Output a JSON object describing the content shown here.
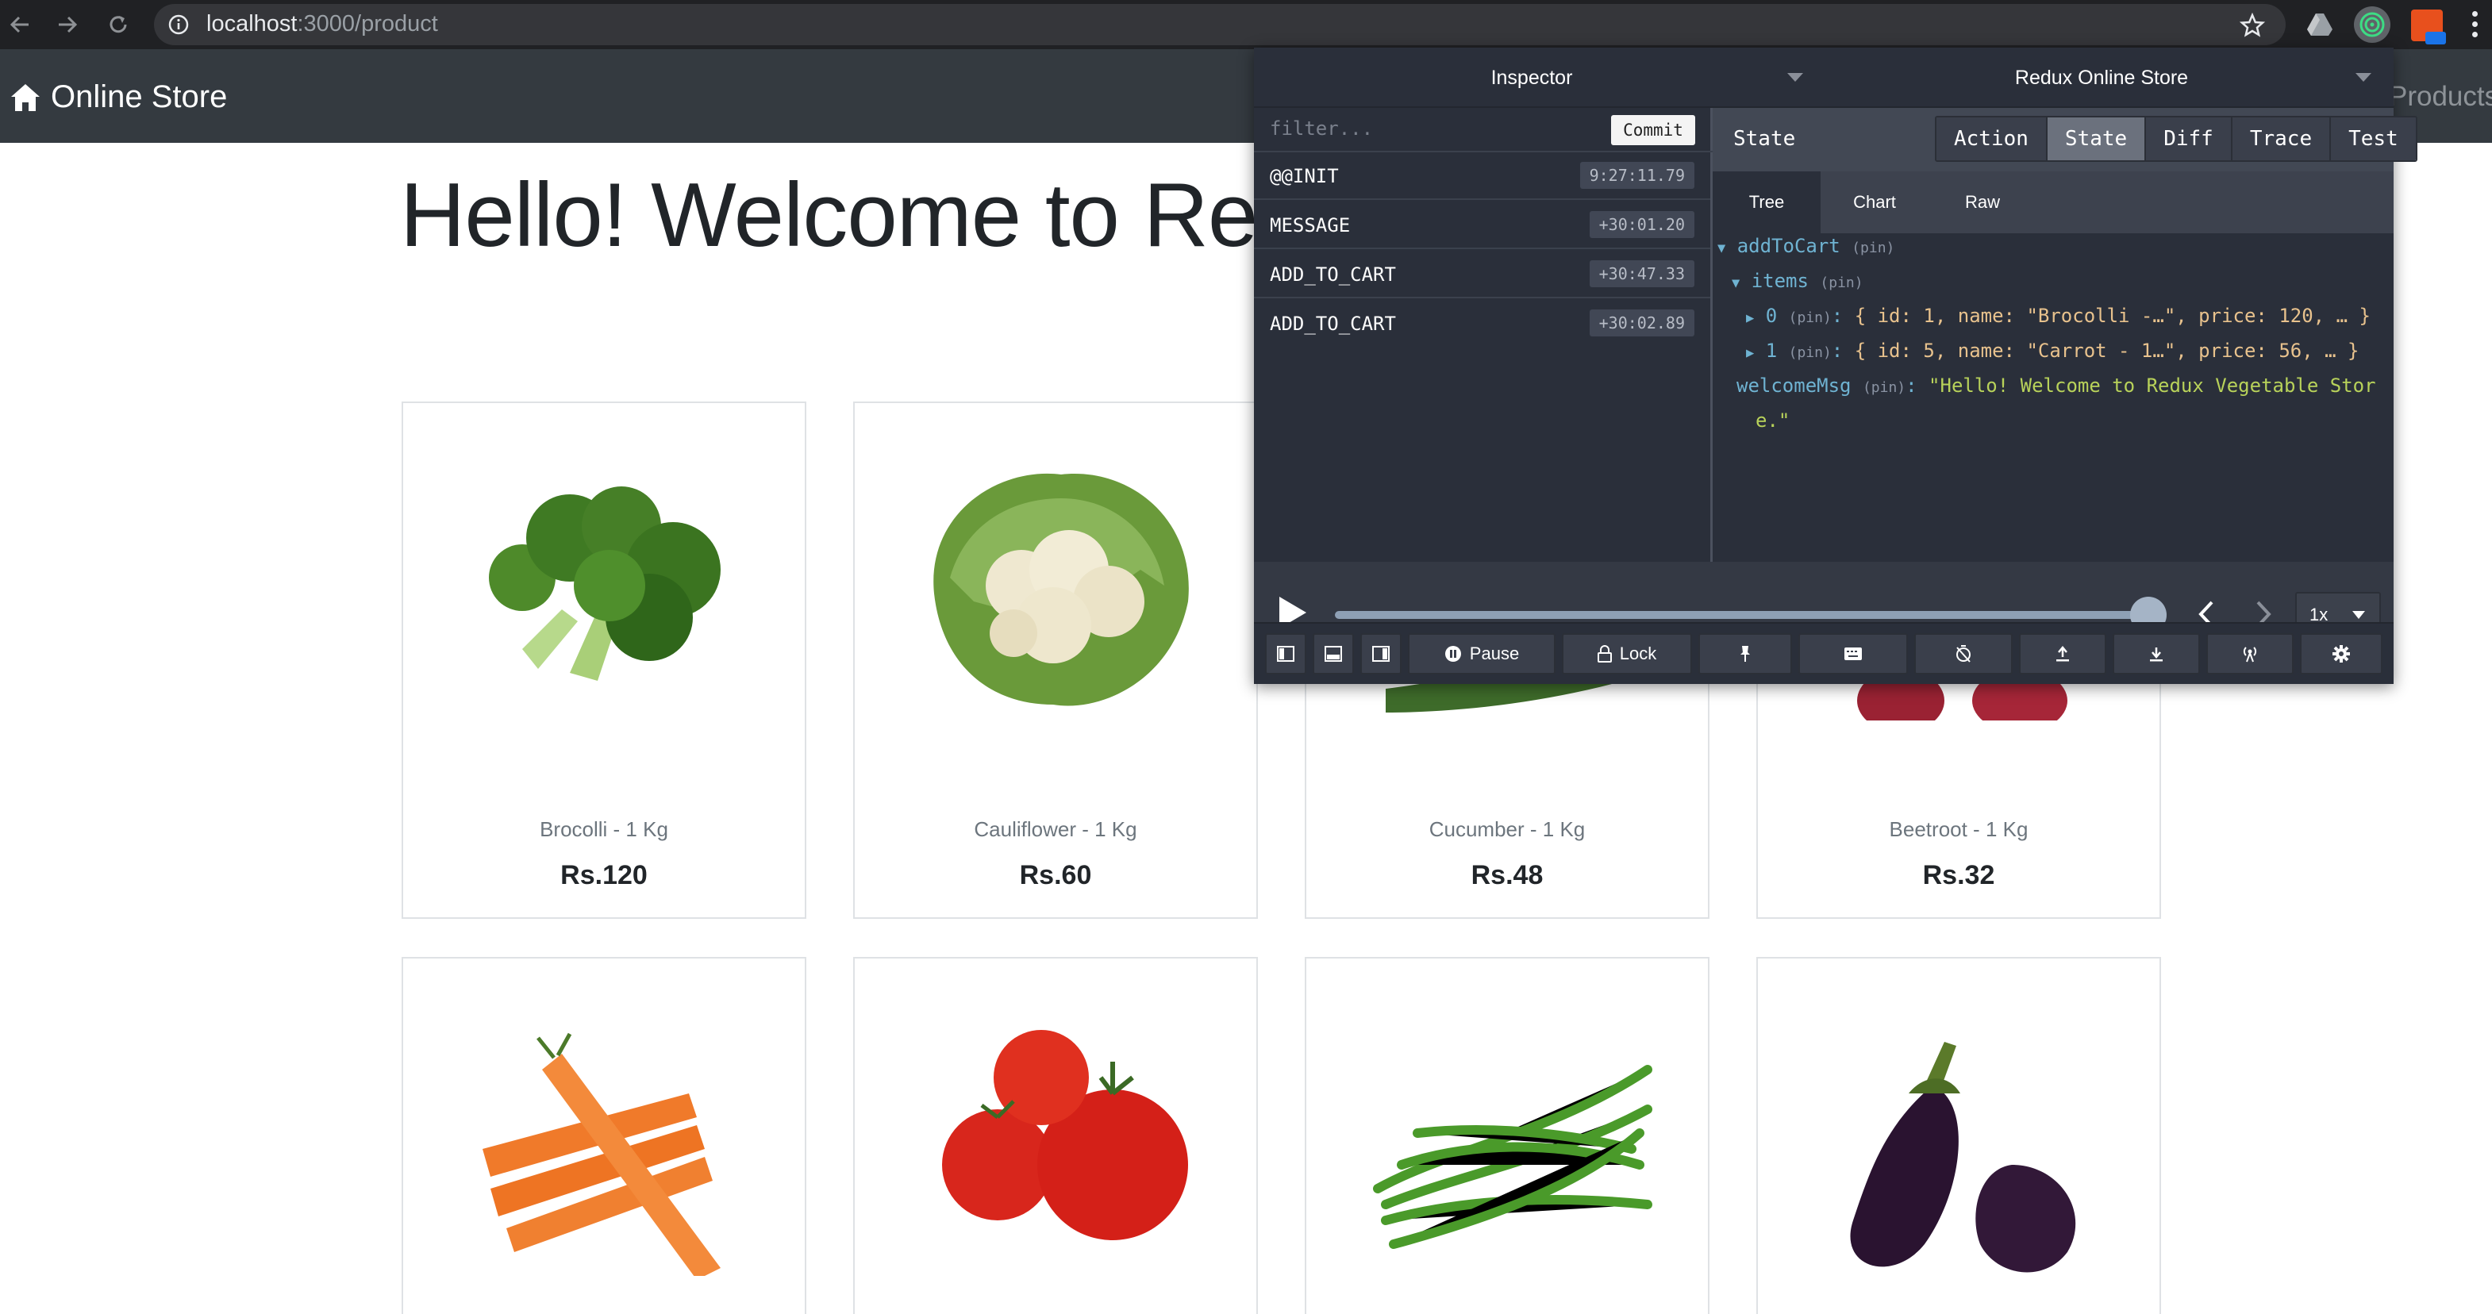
{
  "browser": {
    "url_host": "localhost",
    "url_path": ":3000/product"
  },
  "navbar": {
    "brand": "Online Store",
    "products_link": "Products"
  },
  "page": {
    "welcome": "Hello! Welcome to Redu"
  },
  "products": [
    {
      "name": "Brocolli - 1 Kg",
      "price": "Rs.120",
      "icon": "broccoli-image"
    },
    {
      "name": "Cauliflower - 1 Kg",
      "price": "Rs.60",
      "icon": "cauliflower-image"
    },
    {
      "name": "Cucumber - 1 Kg",
      "price": "Rs.48",
      "icon": "cucumber-image"
    },
    {
      "name": "Beetroot - 1 Kg",
      "price": "Rs.32",
      "icon": "beetroot-image"
    },
    {
      "name": "",
      "price": "",
      "icon": "carrot-image"
    },
    {
      "name": "",
      "price": "",
      "icon": "tomato-image"
    },
    {
      "name": "",
      "price": "",
      "icon": "green-beans-image"
    },
    {
      "name": "",
      "price": "",
      "icon": "eggplant-image"
    }
  ],
  "devtools": {
    "monitor": "Inspector",
    "store": "Redux Online Store",
    "filter_placeholder": "filter...",
    "commit": "Commit",
    "actions": [
      {
        "name": "@@INIT",
        "time": "9:27:11.79"
      },
      {
        "name": "MESSAGE",
        "time": "+30:01.20"
      },
      {
        "name": "ADD_TO_CART",
        "time": "+30:47.33"
      },
      {
        "name": "ADD_TO_CART",
        "time": "+30:02.89"
      }
    ],
    "panel_label": "State",
    "tabs": [
      {
        "label": "Action",
        "active": false
      },
      {
        "label": "State",
        "active": true
      },
      {
        "label": "Diff",
        "active": false
      },
      {
        "label": "Trace",
        "active": false
      },
      {
        "label": "Test",
        "active": false
      }
    ],
    "subtabs": [
      {
        "label": "Tree",
        "active": true
      },
      {
        "label": "Chart",
        "active": false
      },
      {
        "label": "Raw",
        "active": false
      }
    ],
    "tree": {
      "pin": "(pin)",
      "root_key": "addToCart",
      "items_key": "items",
      "item0_index": "0",
      "item0_value": "{ id: 1, name: \"Brocolli -…\", price: 120, … }",
      "item1_index": "1",
      "item1_value": "{ id: 5, name: \"Carrot - 1…\", price: 56, … }",
      "welcome_key": "welcomeMsg",
      "welcome_value_line1": "\"Hello! Welcome to Redux Vegetable Stor",
      "welcome_value_line2": "e.\""
    },
    "speed": "1x",
    "footer": {
      "pause": "Pause",
      "lock": "Lock"
    }
  },
  "colors": {
    "navbar_bg": "#343a40",
    "devtools_bg": "#2a2f3a",
    "tree_key": "#6fb3d2",
    "tree_string": "#b8d25a",
    "tree_value": "#e8c28d"
  }
}
